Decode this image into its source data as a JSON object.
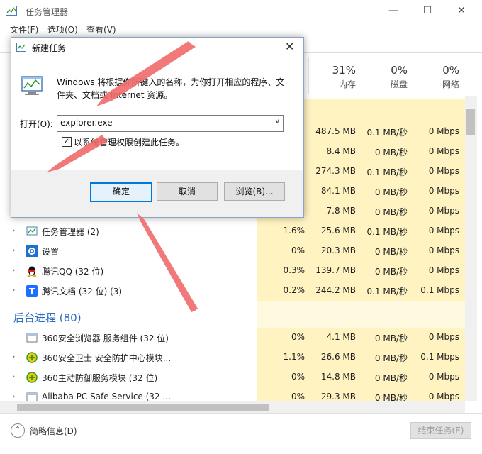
{
  "app": {
    "title": "任务管理器",
    "menu": [
      "文件(F)",
      "选项(O)",
      "查看(V)"
    ]
  },
  "columns": [
    {
      "pct": "31%",
      "label": "内存"
    },
    {
      "pct": "0%",
      "label": "磁盘"
    },
    {
      "pct": "0%",
      "label": "网络"
    }
  ],
  "hidden_rows": [
    {
      "mem": "487.5 MB",
      "disk": "0.1 MB/秒",
      "net": "0 Mbps"
    },
    {
      "mem": "8.4 MB",
      "disk": "0 MB/秒",
      "net": "0 Mbps"
    },
    {
      "mem": "274.3 MB",
      "disk": "0.1 MB/秒",
      "net": "0 Mbps"
    },
    {
      "mem": "84.1 MB",
      "disk": "0 MB/秒",
      "net": "0 Mbps"
    },
    {
      "mem": "7.8 MB",
      "disk": "0 MB/秒",
      "net": "0 Mbps"
    }
  ],
  "apps": [
    {
      "name": "任务管理器 (2)",
      "cpu": "1.6%",
      "mem": "25.6 MB",
      "disk": "0.1 MB/秒",
      "net": "0 Mbps"
    },
    {
      "name": "设置",
      "cpu": "0%",
      "mem": "20.3 MB",
      "disk": "0 MB/秒",
      "net": "0 Mbps"
    },
    {
      "name": "腾讯QQ (32 位)",
      "cpu": "0.3%",
      "mem": "139.7 MB",
      "disk": "0 MB/秒",
      "net": "0 Mbps"
    },
    {
      "name": "腾讯文档 (32 位) (3)",
      "cpu": "0.2%",
      "mem": "244.2 MB",
      "disk": "0.1 MB/秒",
      "net": "0.1 Mbps"
    }
  ],
  "background_group": "后台进程 (80)",
  "background": [
    {
      "name": "360安全浏览器 服务组件 (32 位)",
      "cpu": "0%",
      "mem": "4.1 MB",
      "disk": "0 MB/秒",
      "net": "0 Mbps"
    },
    {
      "name": "360安全卫士 安全防护中心模块...",
      "cpu": "1.1%",
      "mem": "26.6 MB",
      "disk": "0 MB/秒",
      "net": "0.1 Mbps"
    },
    {
      "name": "360主动防御服务模块 (32 位)",
      "cpu": "0%",
      "mem": "14.8 MB",
      "disk": "0 MB/秒",
      "net": "0 Mbps"
    },
    {
      "name": "Alibaba PC Safe Service (32 ...",
      "cpu": "0%",
      "mem": "29.3 MB",
      "disk": "0 MB/秒",
      "net": "0 Mbps"
    }
  ],
  "footer": {
    "fewer_details": "简略信息(D)",
    "end_task": "结束任务(E)"
  },
  "dialog": {
    "title": "新建任务",
    "description": "Windows 将根据你所键入的名称，为你打开相应的程序、文件夹、文档或 Internet 资源。",
    "open_label": "打开(O):",
    "open_value": "explorer.exe",
    "checkbox_label": "以系统管理权限创建此任务。",
    "checkbox_checked": true,
    "ok": "确定",
    "cancel": "取消",
    "browse": "浏览(B)..."
  },
  "colors": {
    "accent": "#0078d7",
    "highlight": "#fff3c2",
    "annotation_arrow": "#f06a6a",
    "group_title": "#2b6cc4"
  }
}
